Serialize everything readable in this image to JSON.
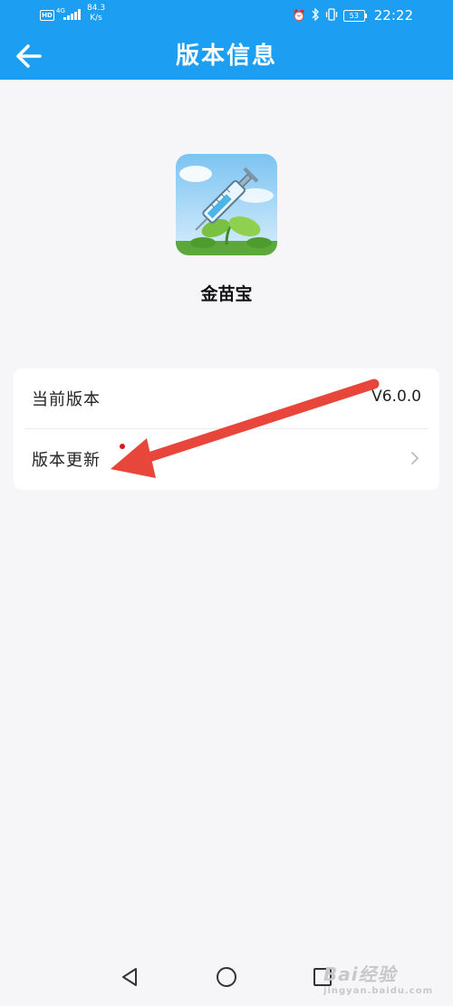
{
  "status_bar": {
    "hd": "HD",
    "signal_label": "4G",
    "speed_value": "84.3",
    "speed_unit": "K/s",
    "battery": "53",
    "time": "22:22"
  },
  "header": {
    "title": "版本信息",
    "back_icon": "arrow-left-icon"
  },
  "app": {
    "name": "金苗宝",
    "icon": "syringe-seedling-icon"
  },
  "version_card": {
    "rows": [
      {
        "label": "当前版本",
        "value": "V6.0.0"
      },
      {
        "label": "版本更新",
        "has_badge": true,
        "chevron": "chevron-right-icon"
      }
    ]
  },
  "system_nav": {
    "back": "triangle-back-icon",
    "home": "circle-home-icon",
    "recents": "square-recents-icon"
  },
  "watermark": {
    "text": "Bai经验",
    "sub": "jingyan.baidu.com"
  },
  "colors": {
    "header_bg": "#1c9ff2",
    "page_bg": "#f6f6f9",
    "badge": "#e0141e",
    "annotation_arrow": "#e8463a"
  }
}
